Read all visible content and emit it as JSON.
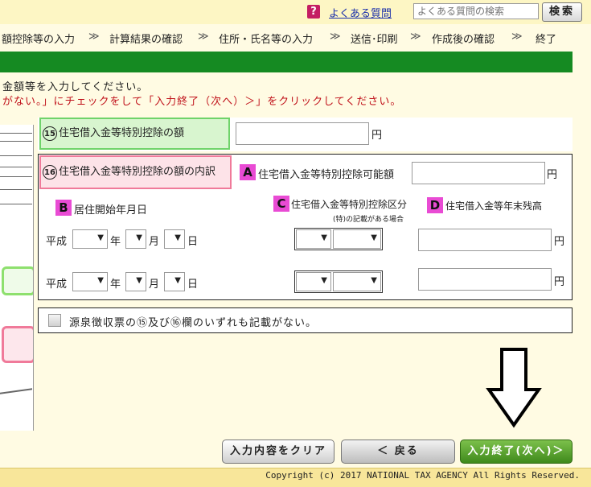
{
  "topbar": {
    "faq_icon": "?",
    "faq_link": "よくある質問",
    "search_placeholder": "よくある質問の検索",
    "search_button": "検索"
  },
  "steps": [
    "額控除等の入力",
    "計算結果の確認",
    "住所・氏名等の入力",
    "送信･印刷",
    "作成後の確認",
    "終了"
  ],
  "step_separator": "≫",
  "instructions": {
    "line1": "金額等を入力してください。",
    "line2": "がない。」にチェックをして「入力終了（次へ）＞」をクリックしてください。"
  },
  "field15": {
    "num": "15",
    "label": "住宅借入金等特別控除の額",
    "unit": "円",
    "value": ""
  },
  "field16": {
    "num": "16",
    "label": "住宅借入金等特別控除の額の内訳",
    "A": {
      "letter": "A",
      "label": "住宅借入金等特別控除可能額",
      "unit": "円",
      "value": ""
    },
    "B": {
      "letter": "B",
      "label": "居住開始年月日"
    },
    "C": {
      "letter": "C",
      "label": "住宅借入金等特別控除区分",
      "sublabel": "(特)の記載がある場合"
    },
    "D": {
      "letter": "D",
      "label": "住宅借入金等年末残高",
      "unit": "円"
    },
    "rows": [
      {
        "era": "平成",
        "year_unit": "年",
        "month_unit": "月",
        "day_unit": "日",
        "yen": "円"
      },
      {
        "era": "平成",
        "year_unit": "年",
        "month_unit": "月",
        "day_unit": "日",
        "yen": "円"
      }
    ]
  },
  "checkbox": {
    "label": "源泉徴収票の⑮及び⑯欄のいずれも記載がない。",
    "checked": false
  },
  "buttons": {
    "clear": "入力内容をクリア",
    "back": "＜ 戻る",
    "next": "入力終了(次へ)＞"
  },
  "footer": {
    "copyright": "Copyright (c) 2017 NATIONAL TAX AGENCY All Rights Reserved."
  },
  "colors": {
    "green_bar": "#158a22",
    "letter_badge": "#e94bd4",
    "faq_icon": "#c41d63",
    "next_button": "#3f8a1c"
  },
  "icons": [
    "help-icon",
    "dropdown-icon",
    "down-arrow-icon"
  ]
}
